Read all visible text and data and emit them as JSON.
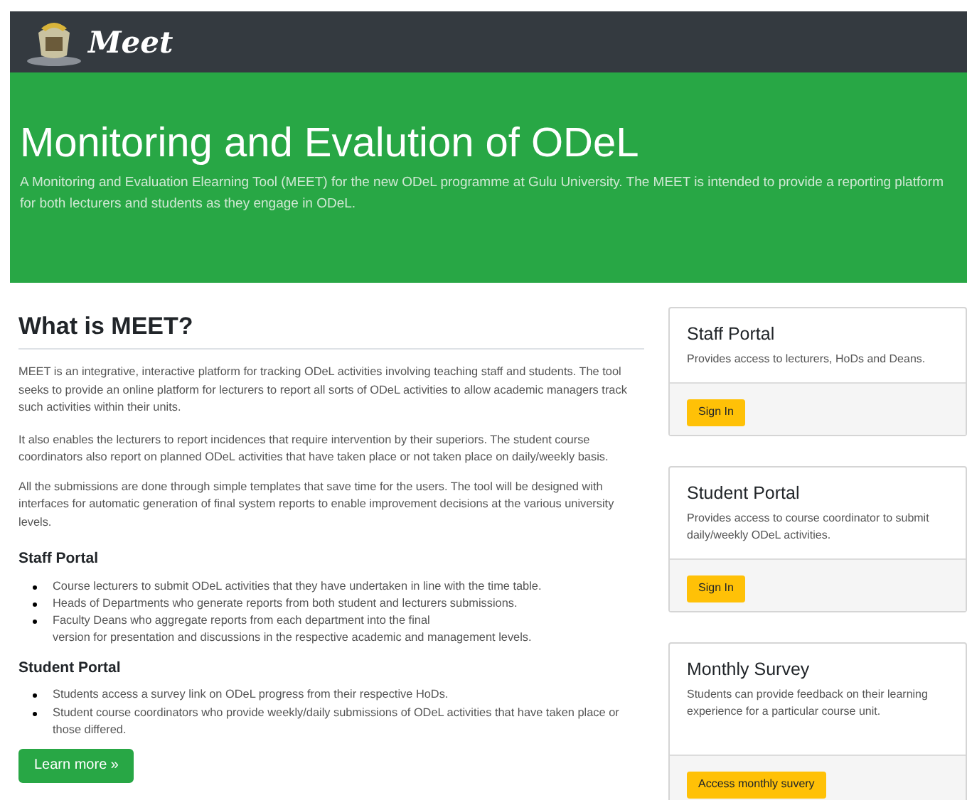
{
  "navbar": {
    "brand": "Meet"
  },
  "hero": {
    "title": "Monitoring and Evalution of ODeL",
    "lead": "A Monitoring and Evaluation Elearning Tool (MEET) for the new ODeL programme at Gulu University. The MEET is intended to provide a reporting platform for both lecturers and students as they engage in ODeL."
  },
  "about": {
    "heading": "What is MEET?",
    "paragraphs": [
      "MEET is an integrative, interactive platform for tracking ODeL activities involving teaching staff and students. The tool seeks to provide an online platform for lecturers to report all sorts of ODeL activities to allow academic managers track such activities within their units.",
      "It also enables the lecturers to report incidences that require intervention by their superiors. The student course coordinators also report on planned ODeL activities that have taken place or not taken place on daily/weekly basis.",
      "All the submissions are done through simple templates that save time for the users. The tool will be designed with interfaces for automatic generation of final system reports to enable improvement decisions at the various university levels."
    ],
    "sections": [
      {
        "heading": "Staff Portal",
        "items": [
          "Course lecturers to submit ODeL activities that they have undertaken in line with the time table.",
          "Heads of Departments who generate reports from both student and lecturers submissions.",
          "Faculty Deans who aggregate reports from each department into the final\nversion for presentation and discussions in the respective academic and management levels."
        ]
      },
      {
        "heading": "Student Portal",
        "items": [
          "Students access a survey link on ODeL progress from their respective HoDs.",
          "Student course coordinators who provide weekly/daily submissions of ODeL activities that have taken place or those differed."
        ]
      }
    ],
    "button": "Learn more »"
  },
  "cards": [
    {
      "title": "Staff Portal",
      "text": "Provides access to lecturers, HoDs and Deans.",
      "button": "Sign In"
    },
    {
      "title": "Student Portal",
      "text": "Provides access to course coordinator to submit daily/weekly ODeL activities.",
      "button": "Sign In"
    },
    {
      "title": "Monthly Survey",
      "text": "Students can provide feedback on their learning experience for a particular course unit.",
      "button": "Access monthly suvery"
    }
  ]
}
